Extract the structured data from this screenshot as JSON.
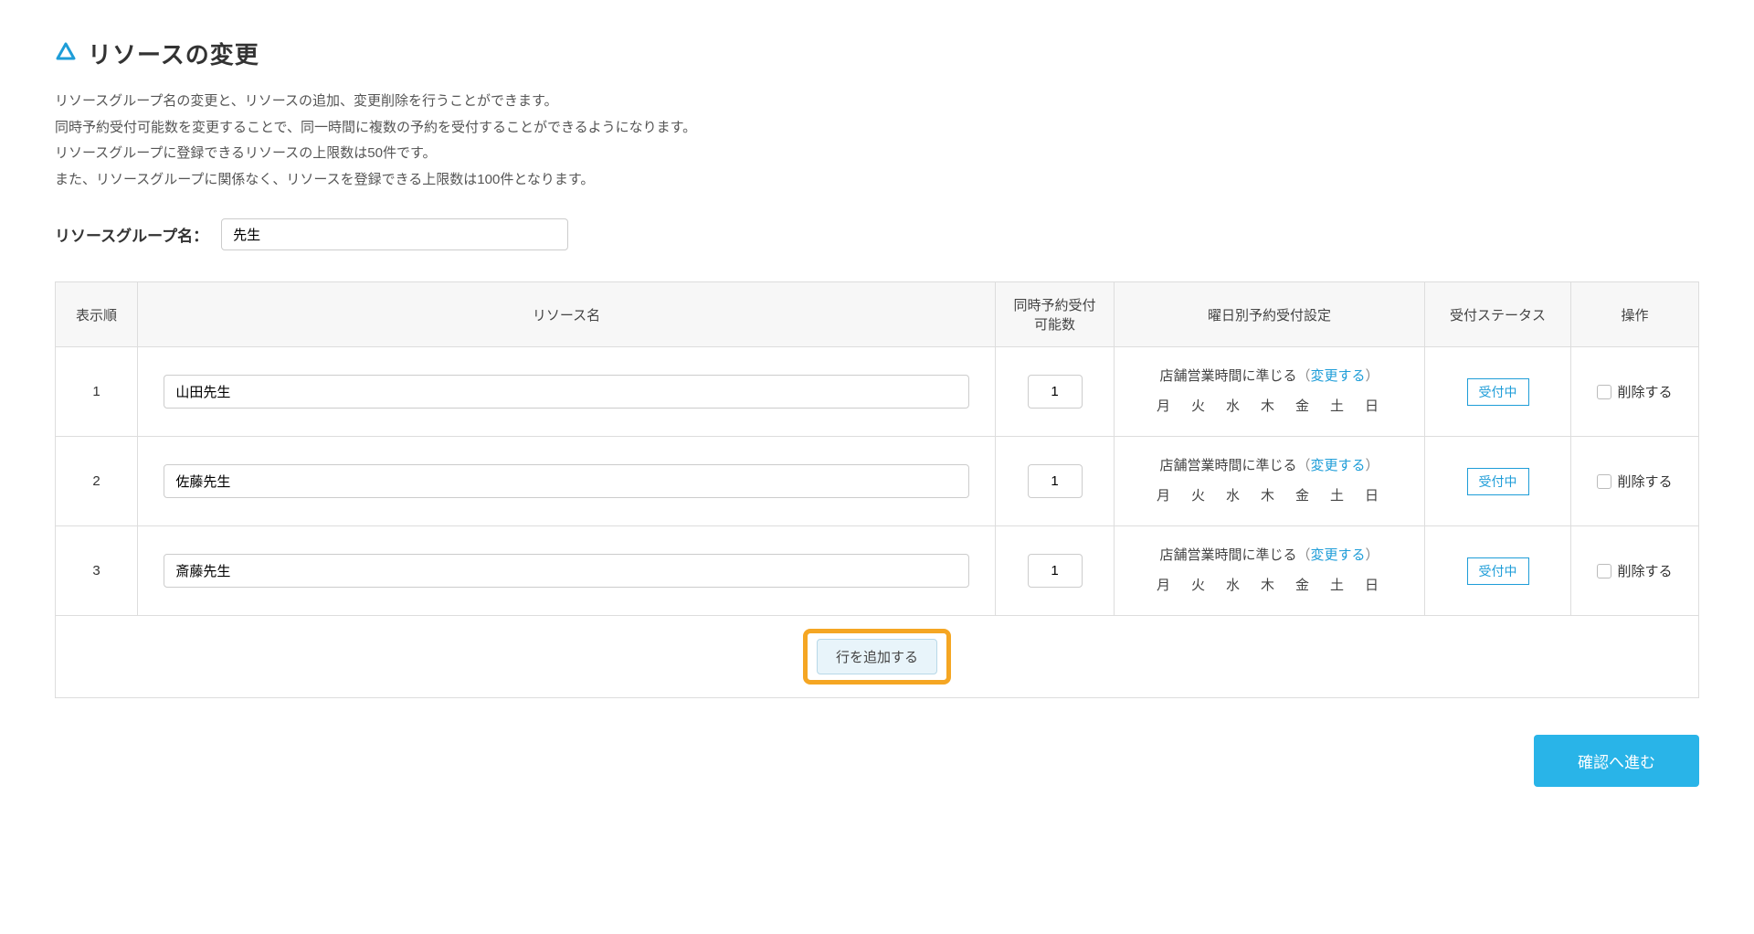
{
  "header": {
    "title": "リソースの変更"
  },
  "description": {
    "line1": "リソースグループ名の変更と、リソースの追加、変更削除を行うことができます。",
    "line2": "同時予約受付可能数を変更することで、同一時間に複数の予約を受付することができるようになります。",
    "line3": "リソースグループに登録できるリソースの上限数は50件です。",
    "line4": "また、リソースグループに関係なく、リソースを登録できる上限数は100件となります。"
  },
  "groupName": {
    "label": "リソースグループ名：",
    "value": "先生"
  },
  "table": {
    "headers": {
      "order": "表示順",
      "name": "リソース名",
      "capacity_line1": "同時予約受付",
      "capacity_line2": "可能数",
      "daySetting": "曜日別予約受付設定",
      "status": "受付ステータス",
      "operation": "操作"
    },
    "daySettingText": "店舗営業時間に準じる",
    "changeLink": "変更する",
    "daysRow": "月　火　水　木　金　土　日",
    "statusLabel": "受付中",
    "deleteLabel": "削除する",
    "rows": [
      {
        "order": "1",
        "name": "山田先生",
        "capacity": "1"
      },
      {
        "order": "2",
        "name": "佐藤先生",
        "capacity": "1"
      },
      {
        "order": "3",
        "name": "斎藤先生",
        "capacity": "1"
      }
    ],
    "addRowLabel": "行を追加する"
  },
  "confirmButton": "確認へ進む"
}
